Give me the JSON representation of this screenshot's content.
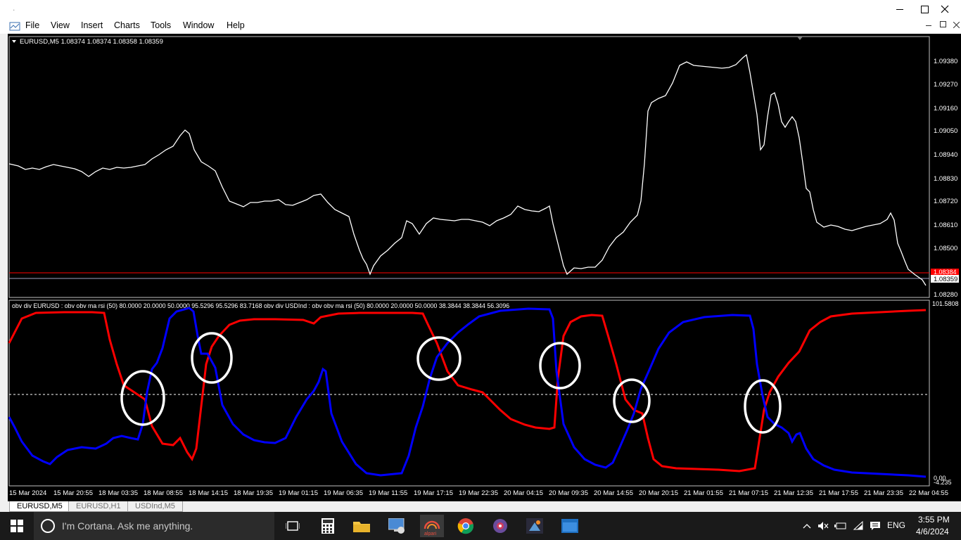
{
  "window": {
    "title": "."
  },
  "menu": {
    "items": [
      "File",
      "View",
      "Insert",
      "Charts",
      "Tools",
      "Window",
      "Help"
    ]
  },
  "chart": {
    "symbol_line": "EURUSD,M5  1.08374 1.08374 1.08358 1.08359",
    "price_axis": [
      "1.09380",
      "1.09270",
      "1.09160",
      "1.09050",
      "1.08940",
      "1.08830",
      "1.08720",
      "1.08610",
      "1.08500",
      "1.08359",
      "1.08280"
    ],
    "red_line_label": "1.08384",
    "current_price_label": "1.08359"
  },
  "indicator": {
    "header": "obv div EURUSD : obv obv ma rsi (50) 80.0000 20.0000 50.0000 95.5296 95.5296 83.7168  obv div USDInd : obv obv ma rsi (50) 80.0000 20.0000 50.0000 38.3844 38.3844 56.3096",
    "top_label": "101.5808",
    "bottom_label_a": "0.00",
    "bottom_label_b": "-4.235"
  },
  "time_axis": [
    "15 Mar 2024",
    "15 Mar 20:55",
    "18 Mar 03:35",
    "18 Mar 08:55",
    "18 Mar 14:15",
    "18 Mar 19:35",
    "19 Mar 01:15",
    "19 Mar 06:35",
    "19 Mar 11:55",
    "19 Mar 17:15",
    "19 Mar 22:35",
    "20 Mar 04:15",
    "20 Mar 09:35",
    "20 Mar 14:55",
    "20 Mar 20:15",
    "21 Mar 01:55",
    "21 Mar 07:15",
    "21 Mar 12:35",
    "21 Mar 17:55",
    "21 Mar 23:35",
    "22 Mar 04:55"
  ],
  "tabs": [
    "EURUSD,M5",
    "EURUSD,H1",
    "USDInd,M5"
  ],
  "taskbar": {
    "cortana_placeholder": "I'm Cortana. Ask me anything.",
    "language": "ENG",
    "time": "3:55 PM",
    "date": "4/6/2024",
    "app_label": "alpari"
  },
  "colors": {
    "red": "#ff0000",
    "blue": "#0000ff",
    "price": "#ffffff",
    "background": "#000000"
  }
}
